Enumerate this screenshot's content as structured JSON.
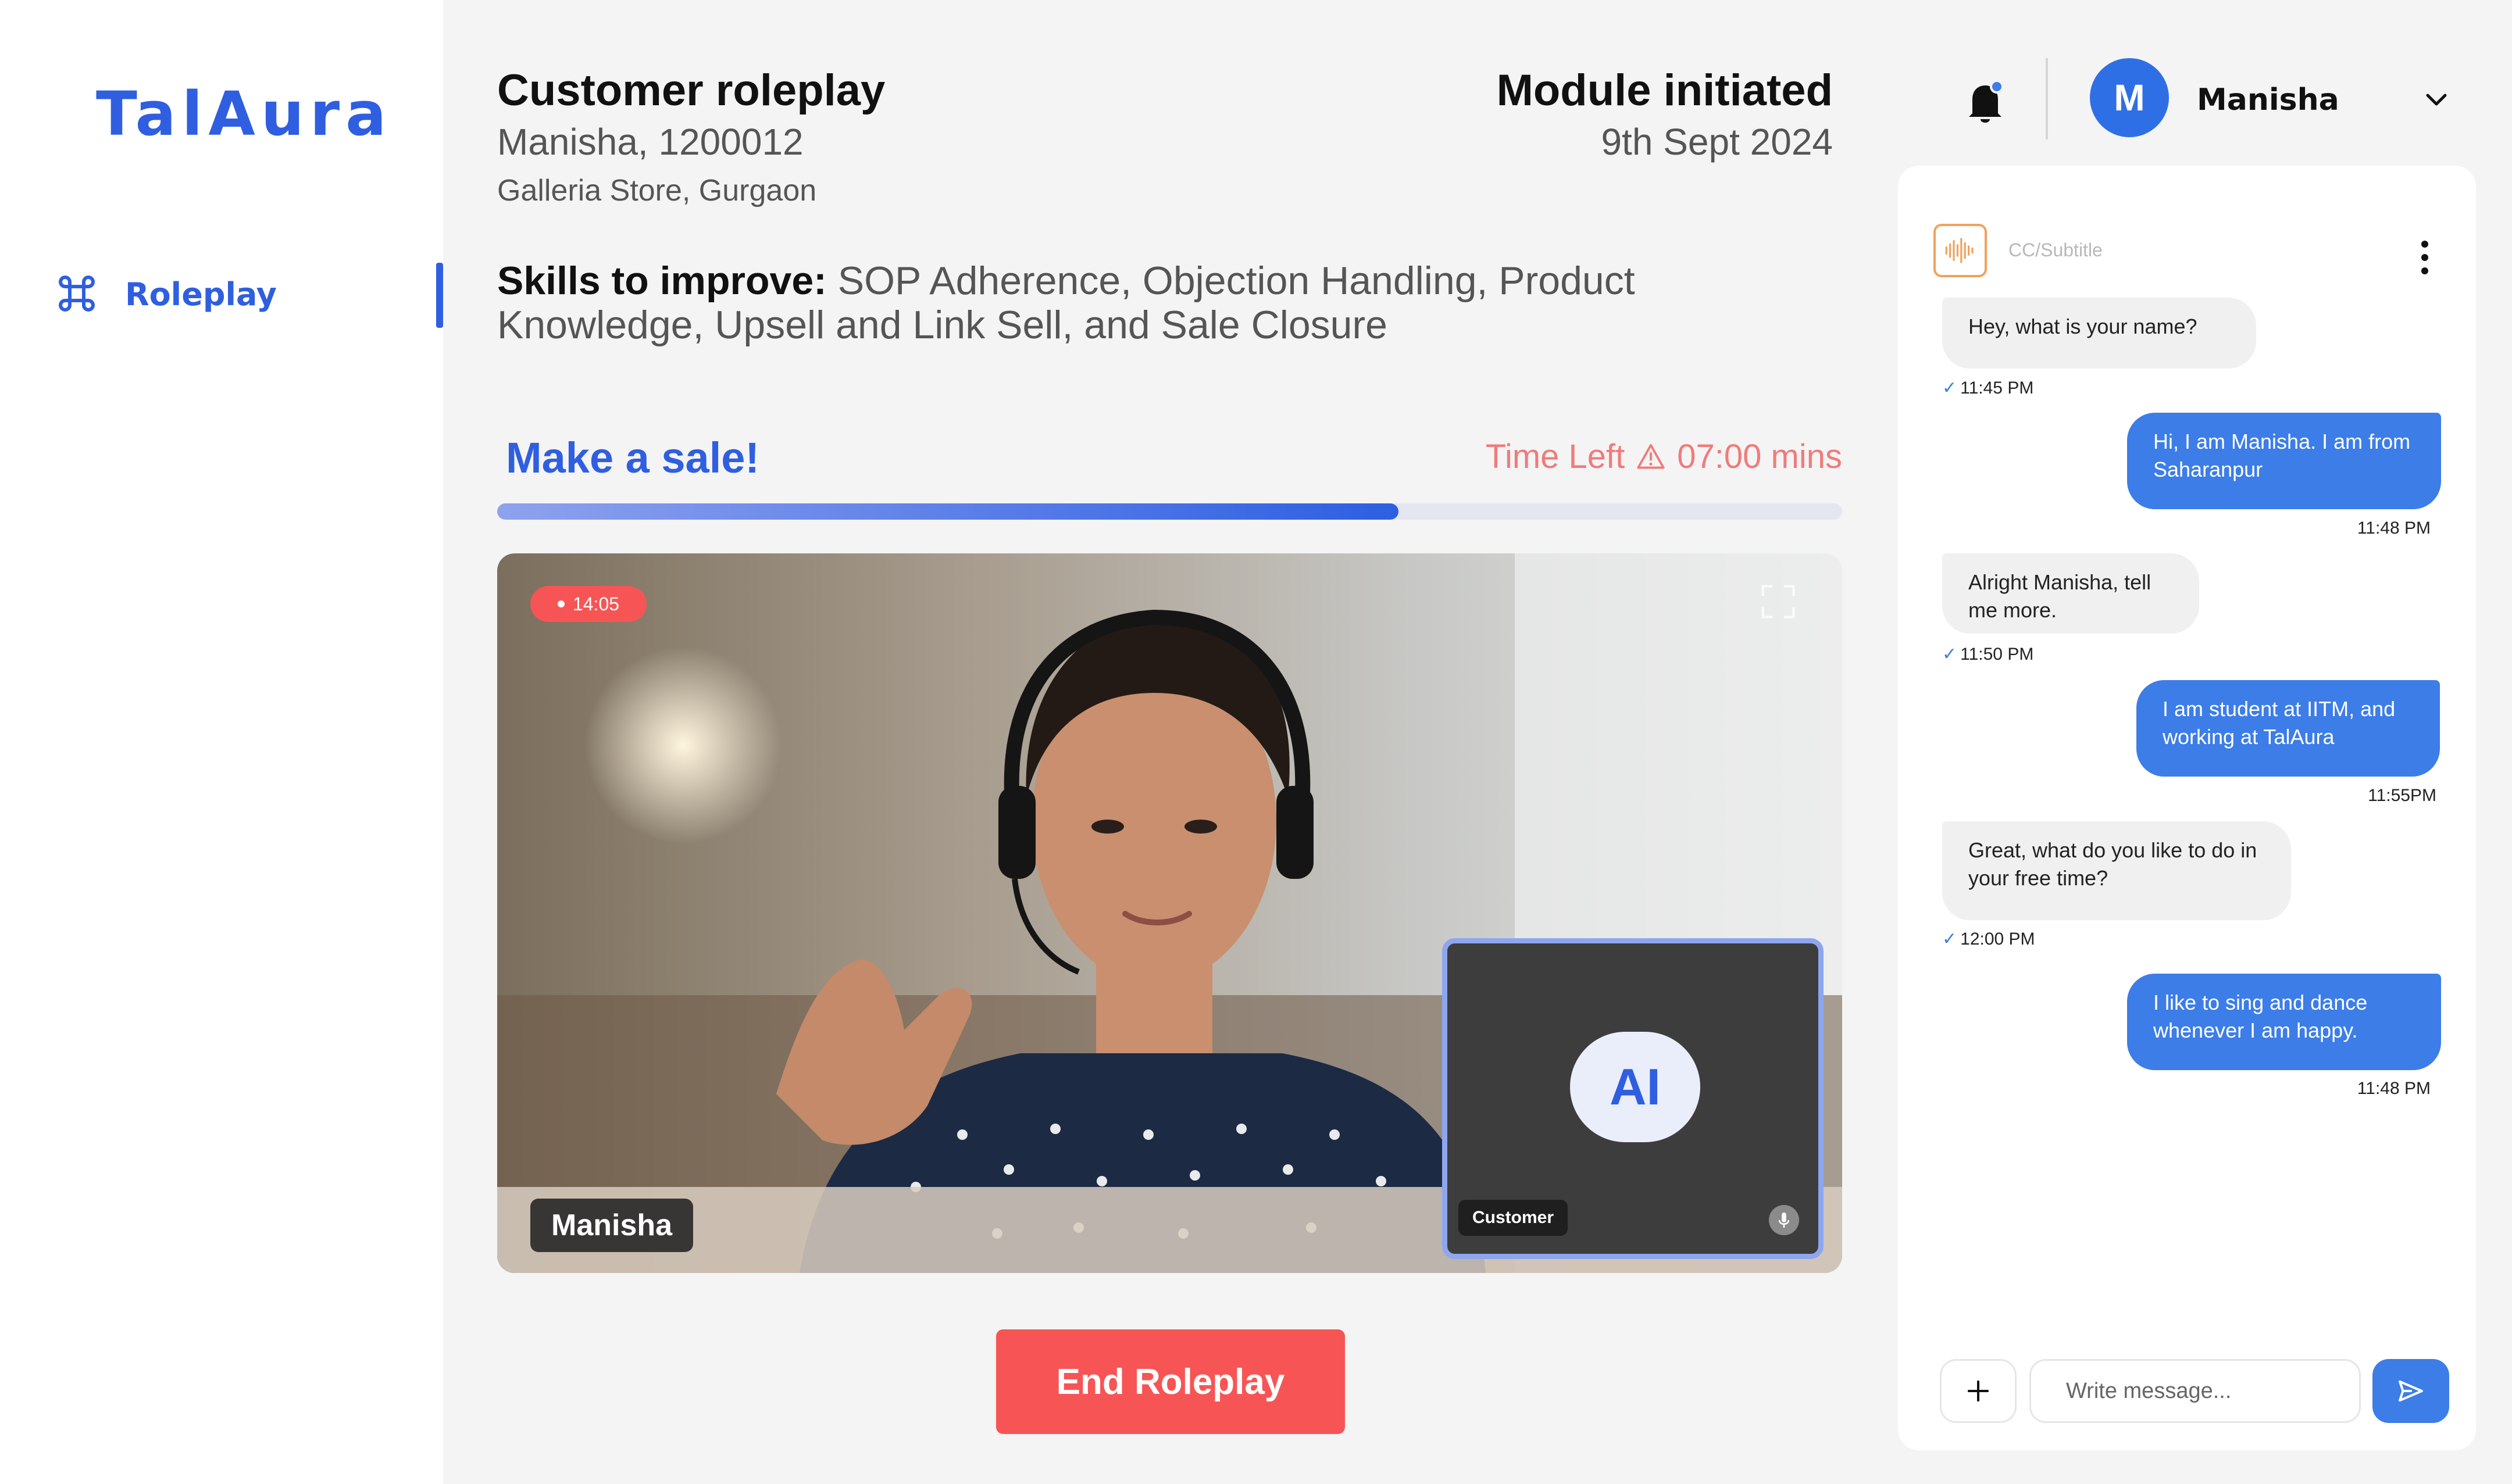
{
  "app": {
    "logo": "TalAura"
  },
  "sidebar": {
    "items": [
      {
        "label": "Roleplay",
        "icon": "command-icon",
        "active": true
      }
    ]
  },
  "header": {
    "title": "Customer roleplay",
    "participant": "Manisha, 1200012",
    "store": "Galleria Store, Gurgaon",
    "module_label": "Module initiated",
    "module_date": "9th Sept 2024",
    "skills_label": "Skills to improve:",
    "skills": "SOP Adherence, Objection Handling, Product Knowledge, Upsell and Link Sell, and Sale Closure"
  },
  "task": {
    "title": "Make a sale!",
    "time_left_label": "Time Left",
    "time_left_value": "07:00 mins",
    "progress_percent": 67
  },
  "video": {
    "recording_time": "14:05",
    "user_name": "Manisha",
    "ai_label": "AI",
    "ai_role": "Customer"
  },
  "actions": {
    "end_label": "End Roleplay"
  },
  "user": {
    "initial": "M",
    "name": "Manisha"
  },
  "chat": {
    "caption_label": "CC/Subtitle",
    "messages": [
      {
        "from": "ai",
        "text": "Hey, what is your name?",
        "time": "11:45 PM"
      },
      {
        "from": "user",
        "text": "Hi, I am Manisha. I am from Saharanpur",
        "time": "11:48 PM"
      },
      {
        "from": "ai",
        "text": "Alright Manisha, tell me more.",
        "time": "11:50 PM"
      },
      {
        "from": "user",
        "text": "I am student at IITM, and working at TalAura",
        "time": "11:55PM"
      },
      {
        "from": "ai",
        "text": "Great, what do you like to do in your free time?",
        "time": "12:00 PM"
      },
      {
        "from": "user",
        "text": "I like to sing and dance whenever I am happy.",
        "time": "11:48 PM"
      }
    ],
    "input_placeholder": "Write message..."
  },
  "colors": {
    "accent": "#2f5fe0",
    "danger": "#f75555",
    "time_left": "#f07b7b",
    "chat_out": "#3c7de8"
  }
}
